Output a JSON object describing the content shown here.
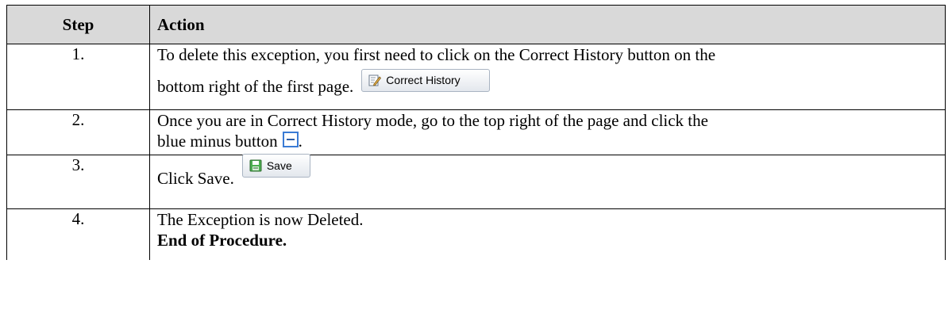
{
  "table": {
    "headers": {
      "step": "Step",
      "action": "Action"
    },
    "rows": [
      {
        "step": "1.",
        "text_line1": "To delete this exception, you first need to click on the Correct History button on the",
        "text_line2": "bottom right of the first page.",
        "button_label": "Correct History",
        "button_icon": "edit-icon"
      },
      {
        "step": "2.",
        "text_line1": "Once you are in Correct History mode, go to the top right of the page and click the",
        "text_line2": "blue minus button",
        "text_after": ".",
        "button_icon": "minus-icon"
      },
      {
        "step": "3.",
        "text_line2": "Click Save.",
        "button_label": "Save",
        "button_icon": "save-icon"
      },
      {
        "step": "4.",
        "text_line1": "The Exception is now Deleted.",
        "end_text": "End of Procedure."
      }
    ]
  },
  "colors": {
    "header_bg": "#d9d9d9",
    "border": "#000000",
    "minus_blue": "#3a7bd5"
  }
}
